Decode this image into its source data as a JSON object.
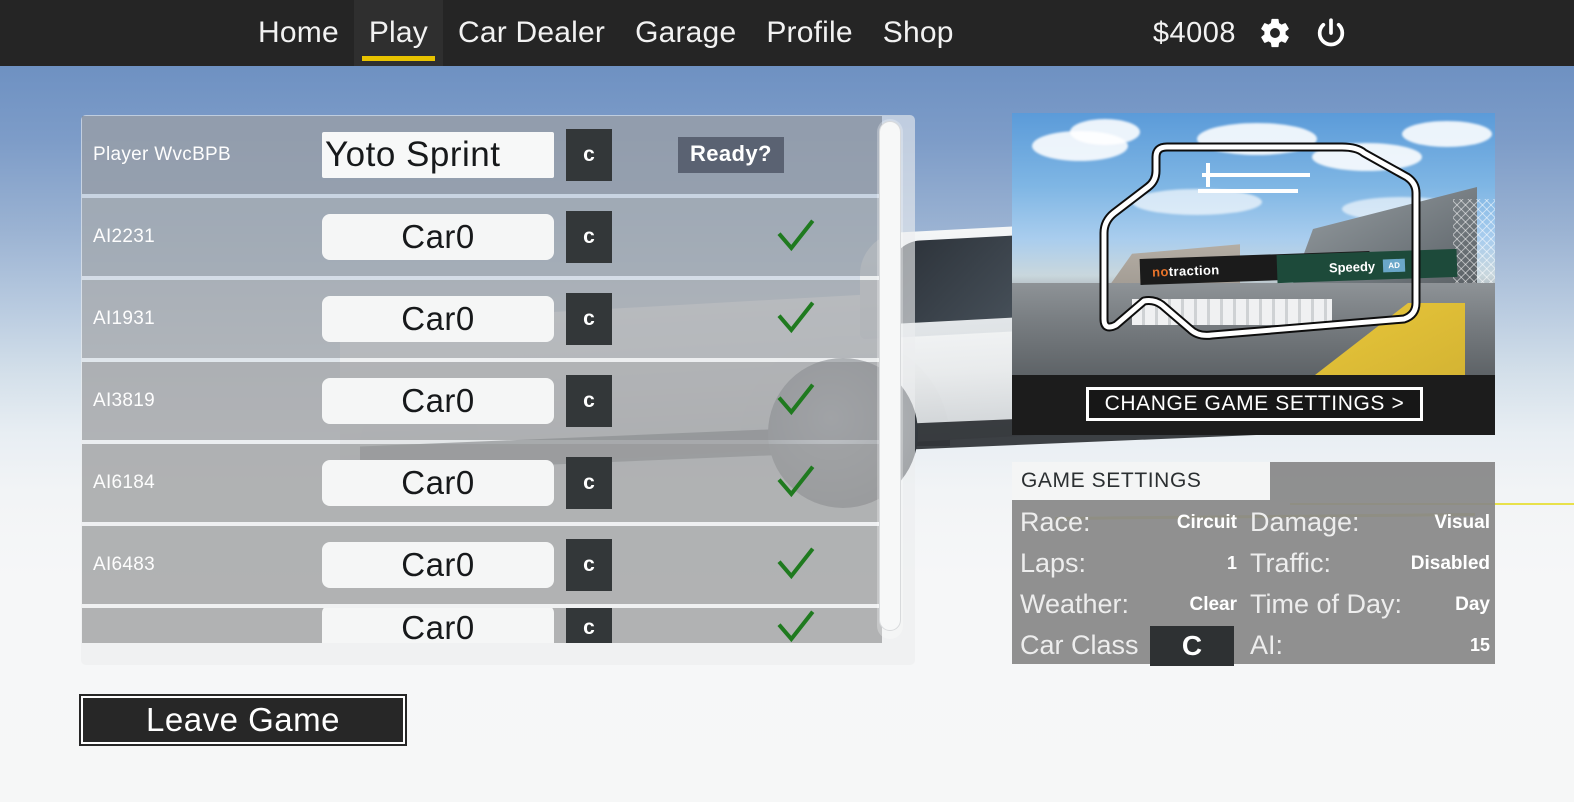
{
  "nav": {
    "items": [
      {
        "label": "Home",
        "active": false
      },
      {
        "label": "Play",
        "active": true
      },
      {
        "label": "Car Dealer",
        "active": false
      },
      {
        "label": "Garage",
        "active": false
      },
      {
        "label": "Profile",
        "active": false
      },
      {
        "label": "Shop",
        "active": false
      }
    ],
    "money": "$4008",
    "settings_icon": "gear-icon",
    "power_icon": "power-icon",
    "active_underline_color": "#e8c300"
  },
  "lobby": {
    "rows": [
      {
        "player": "Player WvcBPB",
        "car": "Yoto Sprint",
        "car_class": "c",
        "status_label": "Ready?",
        "is_player": true,
        "ready": false
      },
      {
        "player": "AI2231",
        "car": "Car0",
        "car_class": "c",
        "is_player": false,
        "ready": true
      },
      {
        "player": "AI1931",
        "car": "Car0",
        "car_class": "c",
        "is_player": false,
        "ready": true
      },
      {
        "player": "AI3819",
        "car": "Car0",
        "car_class": "c",
        "is_player": false,
        "ready": true
      },
      {
        "player": "AI6184",
        "car": "Car0",
        "car_class": "c",
        "is_player": false,
        "ready": true
      },
      {
        "player": "AI6483",
        "car": "Car0",
        "car_class": "c",
        "is_player": false,
        "ready": true
      },
      {
        "player": "",
        "car": "Car0",
        "car_class": "c",
        "is_player": false,
        "ready": true
      }
    ],
    "leave_button": "Leave Game",
    "check_color": "#1f7a1f"
  },
  "preview": {
    "change_settings_label": "CHANGE GAME SETTINGS >",
    "banner_left": "notraction",
    "banner_left_prefix": "no",
    "banner_left_suffix": "traction",
    "banner_right": "Speedy",
    "banner_right_logo": "AD"
  },
  "settings": {
    "title": "GAME SETTINGS",
    "race_label": "Race:",
    "race_value": "Circuit",
    "damage_label": "Damage:",
    "damage_value": "Visual",
    "laps_label": "Laps:",
    "laps_value": "1",
    "traffic_label": "Traffic:",
    "traffic_value": "Disabled",
    "weather_label": "Weather:",
    "weather_value": "Clear",
    "tod_label": "Time of Day:",
    "tod_value": "Day",
    "car_class_label": "Car Class",
    "car_class_value": "C",
    "ai_label": "AI:",
    "ai_value": "15"
  }
}
